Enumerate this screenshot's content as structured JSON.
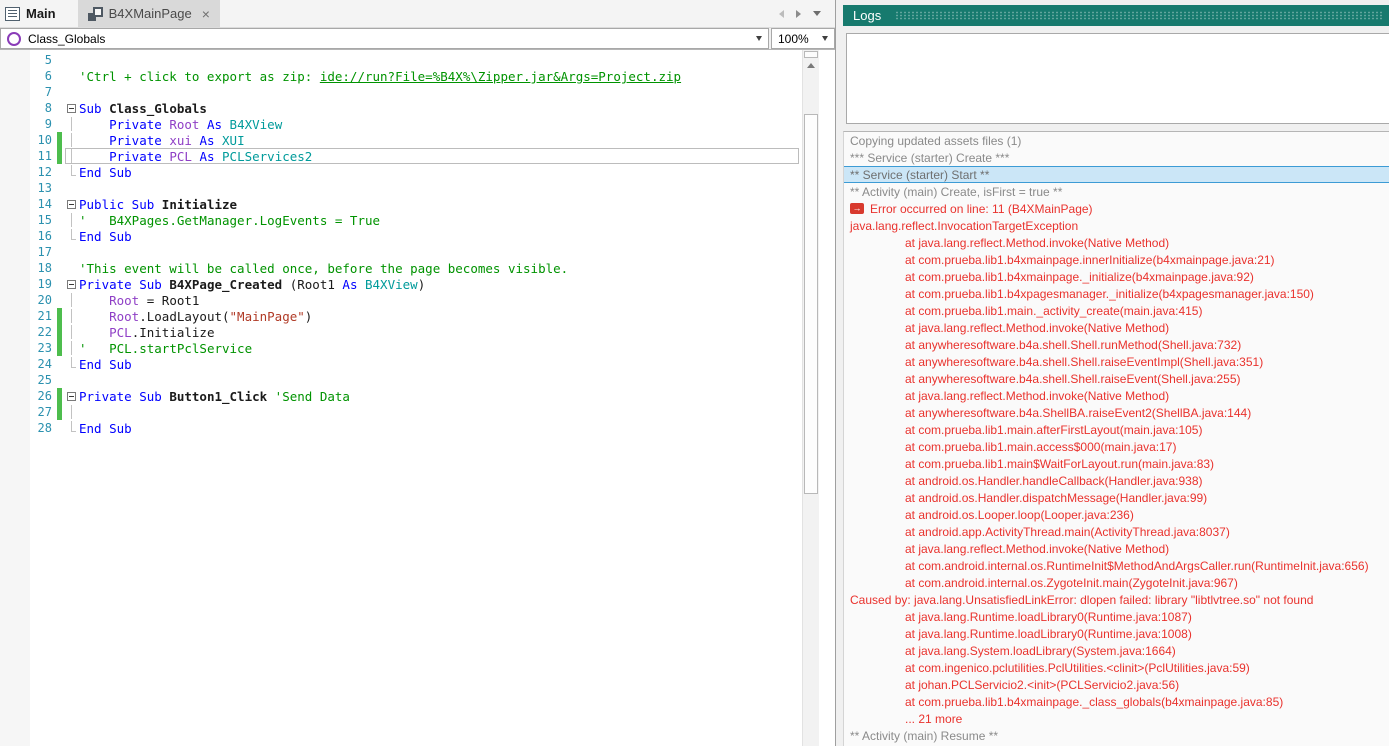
{
  "colors": {
    "accent_teal": "#177A6E",
    "error_red": "#E9322D",
    "info_gray": "#8A8A8A",
    "selection_blue_bg": "#CBE6F7",
    "selection_blue_border": "#3C9BD5",
    "keyword_blue": "#0000FF",
    "type_teal": "#009B9B",
    "member_purple": "#8F3FC6",
    "comment_green": "#009300",
    "string_red": "#B03A26",
    "line_number_teal": "#2B91AF",
    "change_bar_green": "#4DBD4D"
  },
  "tabs": {
    "main": {
      "label": "Main",
      "icon": "form-icon"
    },
    "page": {
      "label": "B4XMainPage",
      "icon": "class-icon",
      "close_icon": "close-icon"
    },
    "nav_icons": [
      "nav-back-icon",
      "nav-forward-icon",
      "nav-dropdown-icon"
    ]
  },
  "toolbar": {
    "member_selector": {
      "value": "Class_Globals",
      "icon": "member-icon"
    },
    "zoom_selector": {
      "value": "100%"
    }
  },
  "editor": {
    "first_line": 5,
    "lines": [
      {
        "num": 5,
        "fold": "",
        "tokens": []
      },
      {
        "num": 6,
        "fold": "",
        "tokens": [
          {
            "t": "'Ctrl + click to export as zip: ",
            "c": "comment"
          },
          {
            "t": "ide://run?File=%B4X%\\Zipper.jar&Args=Project.zip",
            "c": "comment",
            "u": true
          }
        ]
      },
      {
        "num": 7,
        "fold": "",
        "tokens": []
      },
      {
        "num": 8,
        "fold": "start",
        "tokens": [
          {
            "t": "Sub ",
            "c": "kw"
          },
          {
            "t": "Class_Globals",
            "c": "plain",
            "b": true
          }
        ]
      },
      {
        "num": 9,
        "fold": "line",
        "tokens": [
          {
            "t": "\t",
            "c": "plain"
          },
          {
            "t": "Private ",
            "c": "kw"
          },
          {
            "t": "Root ",
            "c": "var"
          },
          {
            "t": "As ",
            "c": "kw"
          },
          {
            "t": "B4XView",
            "c": "type"
          }
        ]
      },
      {
        "num": 10,
        "fold": "line",
        "changed": true,
        "tokens": [
          {
            "t": "\t",
            "c": "plain"
          },
          {
            "t": "Private ",
            "c": "kw"
          },
          {
            "t": "xui ",
            "c": "var"
          },
          {
            "t": "As ",
            "c": "kw"
          },
          {
            "t": "XUI",
            "c": "type"
          }
        ]
      },
      {
        "num": 11,
        "fold": "line",
        "changed": true,
        "current": true,
        "tokens": [
          {
            "t": "\t",
            "c": "plain"
          },
          {
            "t": "Private ",
            "c": "kw"
          },
          {
            "t": "PCL ",
            "c": "var"
          },
          {
            "t": "As ",
            "c": "kw"
          },
          {
            "t": "PCLServices2",
            "c": "type"
          }
        ]
      },
      {
        "num": 12,
        "fold": "end",
        "tokens": [
          {
            "t": "End Sub",
            "c": "kw"
          }
        ]
      },
      {
        "num": 13,
        "fold": "",
        "tokens": []
      },
      {
        "num": 14,
        "fold": "start",
        "tokens": [
          {
            "t": "Public Sub ",
            "c": "kw"
          },
          {
            "t": "Initialize",
            "c": "plain",
            "b": true
          }
        ]
      },
      {
        "num": 15,
        "fold": "line",
        "tokens": [
          {
            "t": "'\tB4XPages.GetManager.LogEvents = True",
            "c": "comment"
          }
        ]
      },
      {
        "num": 16,
        "fold": "end",
        "tokens": [
          {
            "t": "End Sub",
            "c": "kw"
          }
        ]
      },
      {
        "num": 17,
        "fold": "",
        "tokens": []
      },
      {
        "num": 18,
        "fold": "",
        "tokens": [
          {
            "t": "'This event will be called once, before the page becomes visible.",
            "c": "comment"
          }
        ]
      },
      {
        "num": 19,
        "fold": "start",
        "tokens": [
          {
            "t": "Private Sub ",
            "c": "kw"
          },
          {
            "t": "B4XPage_Created ",
            "c": "plain",
            "b": true
          },
          {
            "t": "(Root1 ",
            "c": "plain"
          },
          {
            "t": "As ",
            "c": "kw"
          },
          {
            "t": "B4XView",
            "c": "type"
          },
          {
            "t": ")",
            "c": "plain"
          }
        ]
      },
      {
        "num": 20,
        "fold": "line",
        "tokens": [
          {
            "t": "\t",
            "c": "plain"
          },
          {
            "t": "Root ",
            "c": "var"
          },
          {
            "t": "= Root1",
            "c": "plain"
          }
        ]
      },
      {
        "num": 21,
        "fold": "line",
        "changed": true,
        "tokens": [
          {
            "t": "\t",
            "c": "plain"
          },
          {
            "t": "Root",
            "c": "var"
          },
          {
            "t": ".LoadLayout(",
            "c": "plain"
          },
          {
            "t": "\"MainPage\"",
            "c": "str"
          },
          {
            "t": ")",
            "c": "plain"
          }
        ]
      },
      {
        "num": 22,
        "fold": "line",
        "changed": true,
        "tokens": [
          {
            "t": "\t",
            "c": "plain"
          },
          {
            "t": "PCL",
            "c": "var"
          },
          {
            "t": ".Initialize",
            "c": "plain"
          }
        ]
      },
      {
        "num": 23,
        "fold": "line",
        "changed": true,
        "tokens": [
          {
            "t": "'\tPCL.startPclService",
            "c": "comment"
          }
        ]
      },
      {
        "num": 24,
        "fold": "end",
        "tokens": [
          {
            "t": "End Sub",
            "c": "kw"
          }
        ]
      },
      {
        "num": 25,
        "fold": "",
        "tokens": []
      },
      {
        "num": 26,
        "fold": "start",
        "changed": true,
        "tokens": [
          {
            "t": "Private Sub ",
            "c": "kw"
          },
          {
            "t": "Button1_Click ",
            "c": "plain",
            "b": true
          },
          {
            "t": "'Send Data",
            "c": "comment"
          }
        ]
      },
      {
        "num": 27,
        "fold": "line",
        "changed": true,
        "tokens": []
      },
      {
        "num": 28,
        "fold": "end",
        "tokens": [
          {
            "t": "End Sub",
            "c": "kw"
          }
        ]
      }
    ]
  },
  "logs": {
    "title": "Logs",
    "entries": [
      {
        "text": "Copying updated assets files (1)",
        "kind": "info"
      },
      {
        "text": "*** Service (starter) Create ***",
        "kind": "info"
      },
      {
        "text": "** Service (starter) Start **",
        "kind": "selected"
      },
      {
        "text": "** Activity (main) Create, isFirst = true **",
        "kind": "info"
      },
      {
        "text": "Error occurred on line: 11 (B4XMainPage)",
        "kind": "error",
        "icon": "error-arrow-icon"
      },
      {
        "text": "java.lang.reflect.InvocationTargetException",
        "kind": "error"
      },
      {
        "text": "at java.lang.reflect.Method.invoke(Native Method)",
        "kind": "error",
        "indent": 1
      },
      {
        "text": "at com.prueba.lib1.b4xmainpage.innerInitialize(b4xmainpage.java:21)",
        "kind": "error",
        "indent": 1
      },
      {
        "text": "at com.prueba.lib1.b4xmainpage._initialize(b4xmainpage.java:92)",
        "kind": "error",
        "indent": 1
      },
      {
        "text": "at com.prueba.lib1.b4xpagesmanager._initialize(b4xpagesmanager.java:150)",
        "kind": "error",
        "indent": 1
      },
      {
        "text": "at com.prueba.lib1.main._activity_create(main.java:415)",
        "kind": "error",
        "indent": 1
      },
      {
        "text": "at java.lang.reflect.Method.invoke(Native Method)",
        "kind": "error",
        "indent": 1
      },
      {
        "text": "at anywheresoftware.b4a.shell.Shell.runMethod(Shell.java:732)",
        "kind": "error",
        "indent": 1
      },
      {
        "text": "at anywheresoftware.b4a.shell.Shell.raiseEventImpl(Shell.java:351)",
        "kind": "error",
        "indent": 1
      },
      {
        "text": "at anywheresoftware.b4a.shell.Shell.raiseEvent(Shell.java:255)",
        "kind": "error",
        "indent": 1
      },
      {
        "text": "at java.lang.reflect.Method.invoke(Native Method)",
        "kind": "error",
        "indent": 1
      },
      {
        "text": "at anywheresoftware.b4a.ShellBA.raiseEvent2(ShellBA.java:144)",
        "kind": "error",
        "indent": 1
      },
      {
        "text": "at com.prueba.lib1.main.afterFirstLayout(main.java:105)",
        "kind": "error",
        "indent": 1
      },
      {
        "text": "at com.prueba.lib1.main.access$000(main.java:17)",
        "kind": "error",
        "indent": 1
      },
      {
        "text": "at com.prueba.lib1.main$WaitForLayout.run(main.java:83)",
        "kind": "error",
        "indent": 1
      },
      {
        "text": "at android.os.Handler.handleCallback(Handler.java:938)",
        "kind": "error",
        "indent": 1
      },
      {
        "text": "at android.os.Handler.dispatchMessage(Handler.java:99)",
        "kind": "error",
        "indent": 1
      },
      {
        "text": "at android.os.Looper.loop(Looper.java:236)",
        "kind": "error",
        "indent": 1
      },
      {
        "text": "at android.app.ActivityThread.main(ActivityThread.java:8037)",
        "kind": "error",
        "indent": 1
      },
      {
        "text": "at java.lang.reflect.Method.invoke(Native Method)",
        "kind": "error",
        "indent": 1
      },
      {
        "text": "at com.android.internal.os.RuntimeInit$MethodAndArgsCaller.run(RuntimeInit.java:656)",
        "kind": "error",
        "indent": 1
      },
      {
        "text": "at com.android.internal.os.ZygoteInit.main(ZygoteInit.java:967)",
        "kind": "error",
        "indent": 1
      },
      {
        "text": "Caused by: java.lang.UnsatisfiedLinkError: dlopen failed: library \"libtlvtree.so\" not found",
        "kind": "error"
      },
      {
        "text": "at java.lang.Runtime.loadLibrary0(Runtime.java:1087)",
        "kind": "error",
        "indent": 1
      },
      {
        "text": "at java.lang.Runtime.loadLibrary0(Runtime.java:1008)",
        "kind": "error",
        "indent": 1
      },
      {
        "text": "at java.lang.System.loadLibrary(System.java:1664)",
        "kind": "error",
        "indent": 1
      },
      {
        "text": "at com.ingenico.pclutilities.PclUtilities.<clinit>(PclUtilities.java:59)",
        "kind": "error",
        "indent": 1
      },
      {
        "text": "at johan.PCLServicio2.<init>(PCLServicio2.java:56)",
        "kind": "error",
        "indent": 1
      },
      {
        "text": "at com.prueba.lib1.b4xmainpage._class_globals(b4xmainpage.java:85)",
        "kind": "error",
        "indent": 1
      },
      {
        "text": "... 21 more",
        "kind": "error",
        "indent": 1
      },
      {
        "text": "** Activity (main) Resume **",
        "kind": "info"
      }
    ]
  }
}
